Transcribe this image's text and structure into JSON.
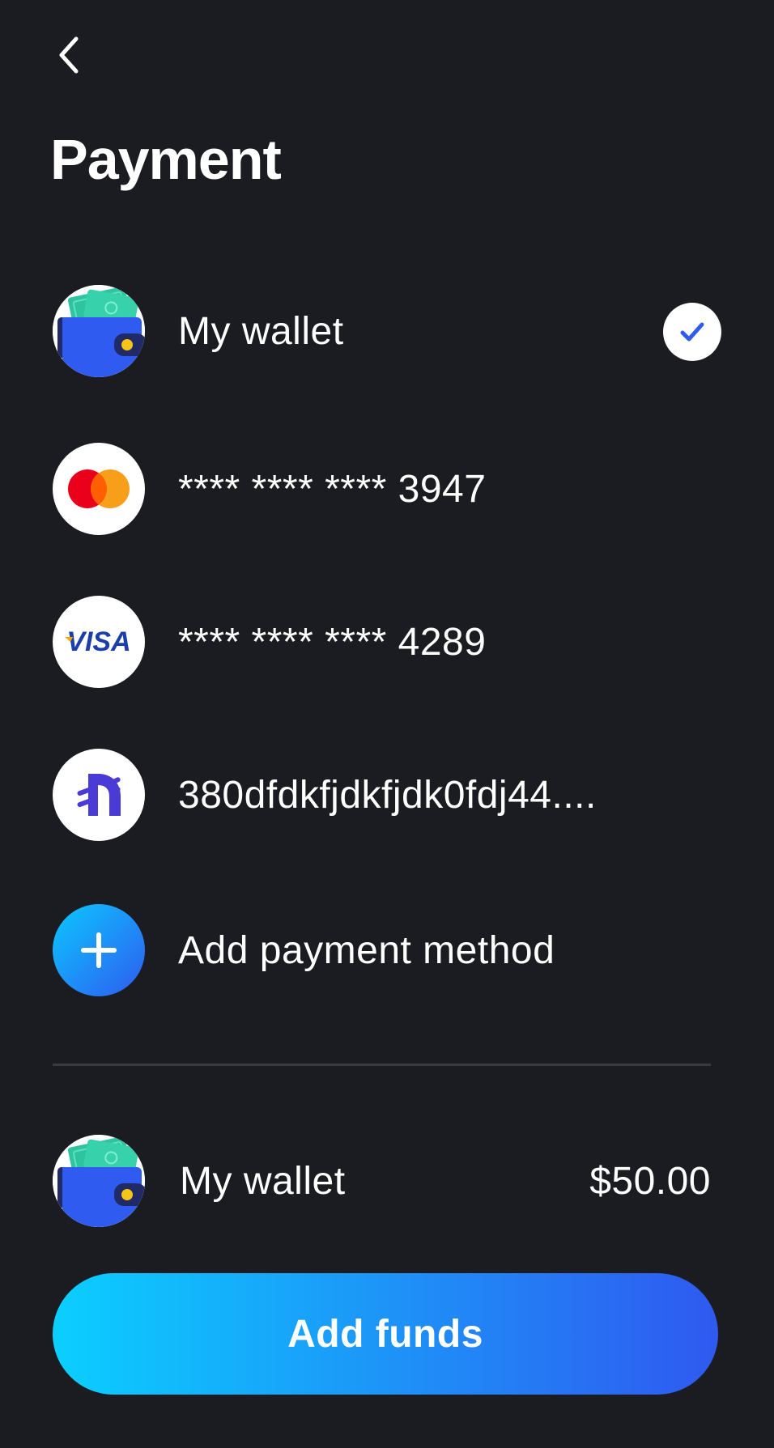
{
  "header": {
    "back_icon": "chevron-left-icon",
    "title": "Payment"
  },
  "methods": [
    {
      "label": "My wallet",
      "icon": "wallet-icon",
      "selected": true
    },
    {
      "label": "**** **** **** 3947",
      "icon": "mastercard-icon",
      "selected": false
    },
    {
      "label": "**** **** **** 4289",
      "icon": "visa-icon",
      "visa_text": "VISA",
      "selected": false
    },
    {
      "label": "380dfdkfjdkfjdk0fdj44....",
      "icon": "crypto-coin-icon",
      "selected": false
    },
    {
      "label": "Add payment method",
      "icon": "plus-icon"
    }
  ],
  "wallet": {
    "label": "My wallet",
    "amount": "$50.00",
    "icon": "wallet-icon"
  },
  "add_funds_label": "Add funds",
  "colors": {
    "background": "#1b1c21",
    "accent_start": "#0bcfff",
    "accent_end": "#2f59f0",
    "wallet_blue": "#2f5bf0",
    "cash_green": "#2ec4a0"
  }
}
